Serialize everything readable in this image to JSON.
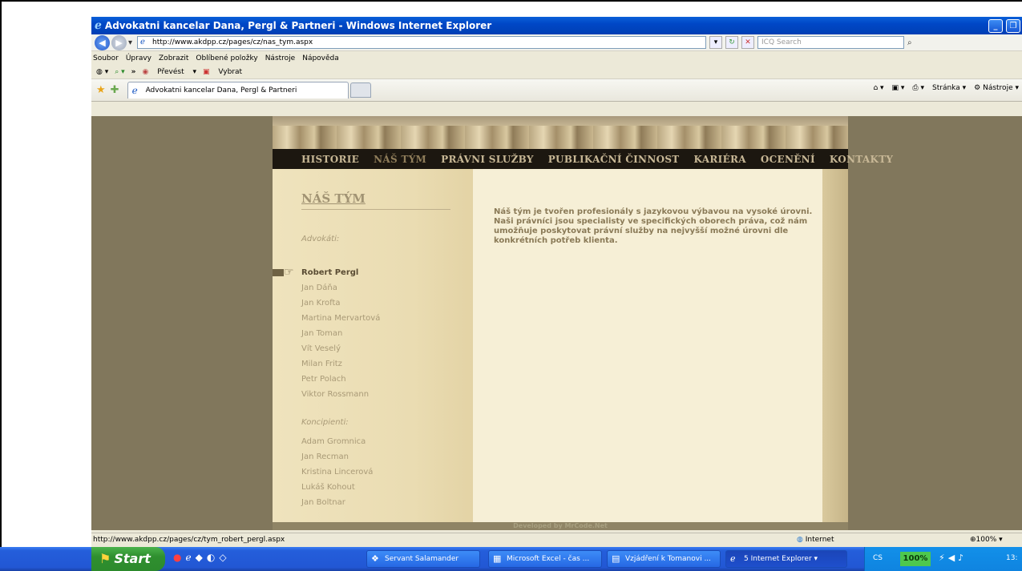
{
  "window": {
    "title": "Advokatni kancelar Dana, Pergl & Partneri - Windows Internet Explorer",
    "min_label": "_",
    "restore_label": "❐"
  },
  "address": {
    "back_icon": "◀",
    "forward_icon": "▶",
    "dropdown_icon": "▾",
    "url": "http://www.akdpp.cz/pages/cz/nas_tym.aspx",
    "search_placeholder": "ICQ Search",
    "search_icon": "⌕"
  },
  "menu": [
    "Soubor",
    "Úpravy",
    "Zobrazit",
    "Oblíbené položky",
    "Nástroje",
    "Nápověda"
  ],
  "toolbar": {
    "chevron": "»",
    "convert_label": "Převést",
    "select_label": "Vybrat"
  },
  "tab": {
    "title": "Advokatni kancelar Dana, Pergl & Partneri"
  },
  "commandbar": {
    "page_label": "Stránka",
    "tools_label": "Nástroje"
  },
  "site": {
    "nav": [
      "HISTORIE",
      "NÁŠ TÝM",
      "PRÁVNI SLUŽBY",
      "PUBLIKAČNÍ ČINNOST",
      "KARIÉRA",
      "OCENĚNÍ",
      "KONTAKTY"
    ],
    "active_nav": "NÁŠ TÝM",
    "page_heading": "NÁŠ TÝM",
    "section_lawyers": "Advokáti:",
    "lawyers": [
      "Robert Pergl",
      "Jan Dáňa",
      "Jan Krofta",
      "Martina Mervartová",
      "Jan Toman",
      "Vít Veselý",
      "Milan Fritz",
      "Petr Polach",
      "Viktor Rossmann"
    ],
    "selected_lawyer": "Robert Pergl",
    "section_associates": "Koncipienti:",
    "associates": [
      "Adam Gromnica",
      "Jan Recman",
      "Kristina Lincerová",
      "Lukáš Kohout",
      "Jan Boltnar"
    ],
    "intro_text": "Náš tým je tvořen profesionály s jazykovou výbavou na vysoké úrovni. Naši právníci jsou specialisty ve specifických oborech práva, což nám umožňuje poskytovat právní služby na nejvyšší možné úrovni dle konkrétních potřeb klienta.",
    "footer": "Developed by MrCode.Net"
  },
  "status": {
    "link": "http://www.akdpp.cz/pages/cz/tym_robert_pergl.aspx",
    "zone": "Internet",
    "zoom": "100%"
  },
  "taskbar": {
    "start_label": "Start",
    "tasks": [
      {
        "label": "Servant Salamander",
        "icon": "❖"
      },
      {
        "label": "Microsoft Excel - čas ...",
        "icon": "▦"
      },
      {
        "label": "Vzjádření k Tomanovi ...",
        "icon": "▤"
      },
      {
        "label": "5 Internet Explorer",
        "icon": "ℯ"
      }
    ],
    "lang": "CS",
    "battery": "100%",
    "clock": "13:"
  },
  "colors": {
    "page_bg": "#81775c",
    "site_bg": "#efe3bd",
    "nav_bg": "#1c1710",
    "taskbar": "#245edb",
    "titlebar": "#0047c6"
  }
}
